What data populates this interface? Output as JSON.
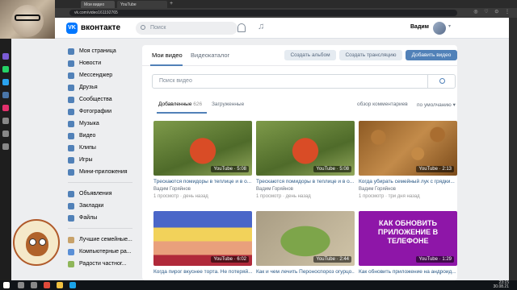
{
  "browser": {
    "tabs": [
      {
        "label": "Мои видео"
      },
      {
        "label": "YouTube"
      }
    ],
    "address": "vk.com/video161192765"
  },
  "header": {
    "logo_text": "вконтакте",
    "search_placeholder": "Поиск",
    "user_name": "Вадим"
  },
  "sidebar": {
    "items": [
      {
        "label": "Моя страница"
      },
      {
        "label": "Новости"
      },
      {
        "label": "Мессенджер"
      },
      {
        "label": "Друзья"
      },
      {
        "label": "Сообщества"
      },
      {
        "label": "Фотографии"
      },
      {
        "label": "Музыка"
      },
      {
        "label": "Видео"
      },
      {
        "label": "Клипы"
      },
      {
        "label": "Игры"
      },
      {
        "label": "Мини-приложения"
      }
    ],
    "items2": [
      {
        "label": "Объявления"
      },
      {
        "label": "Закладки"
      },
      {
        "label": "Файлы"
      }
    ],
    "communities": [
      {
        "label": "Лучшие семейные..."
      },
      {
        "label": "Компьютерные ра..."
      },
      {
        "label": "Радости частног..."
      }
    ]
  },
  "content": {
    "tabs": [
      {
        "label": "Мои видео"
      },
      {
        "label": "Видеокаталог"
      }
    ],
    "buttons": {
      "create_album": "Создать альбом",
      "create_stream": "Создать трансляцию",
      "add_video": "Добавить видео"
    },
    "video_search_placeholder": "Поиск видео",
    "subtabs": {
      "added": "Добавленные",
      "added_count": "626",
      "uploaded": "Загруженные",
      "comments_review": "обзор комментариев",
      "sort": "по умолчанию"
    },
    "videos": [
      {
        "title": "Трескаются помидоры в теплице и в о...",
        "author": "Вадим Горяйнов",
        "meta": "1 просмотр · день назад",
        "badge": "YouTube · 5:08"
      },
      {
        "title": "Трескаются помидоры в теплице и в о...",
        "author": "Вадим Горяйнов",
        "meta": "1 просмотр · день назад",
        "badge": "YouTube · 5:08"
      },
      {
        "title": "Когда убирать семейный лук с грядки...",
        "author": "Вадим Горяйнов",
        "meta": "1 просмотр · три дня назад",
        "badge": "YouTube · 2:13"
      },
      {
        "title": "Когда пирог вкуснее торта. Не потеряй...",
        "author": "",
        "meta": "",
        "badge": "YouTube · 6:02"
      },
      {
        "title": "Как и чем лечить Пероноспороз огурцо...",
        "author": "",
        "meta": "",
        "badge": "YouTube · 2:44"
      },
      {
        "title": "Как обновить приложение на андроид...",
        "author": "",
        "meta": "",
        "badge": "YouTube · 1:29",
        "promo_text": "КАК ОБНОВИТЬ ПРИЛОЖЕНИЕ В ТЕЛЕФОНЕ"
      }
    ]
  },
  "taskbar": {
    "time": "23:15",
    "date": "30.08.21"
  },
  "colors": {
    "vk_blue": "#5181b8",
    "link": "#2a5885",
    "page_bg": "#edeef0"
  }
}
